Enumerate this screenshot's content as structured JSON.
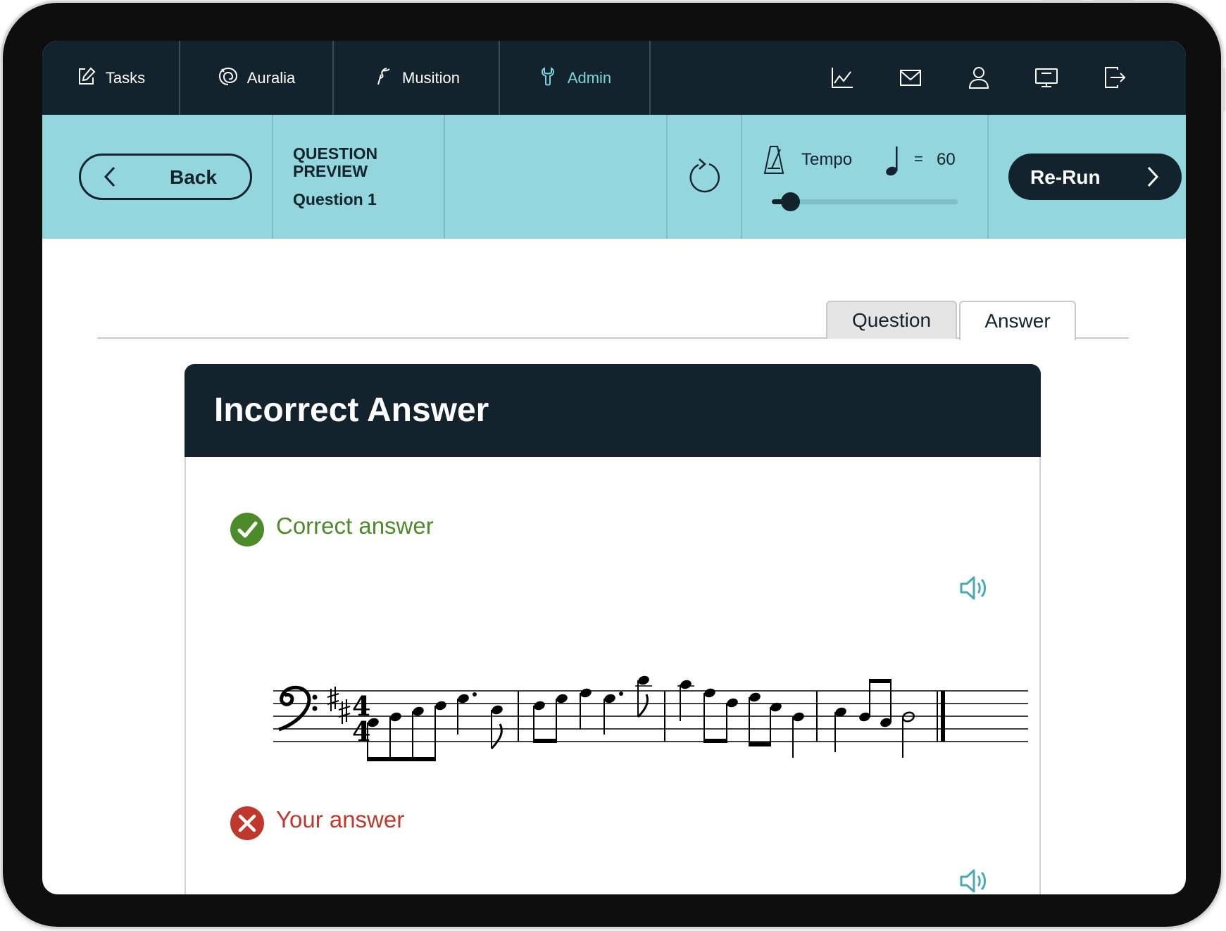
{
  "nav": {
    "items": [
      {
        "label": "Tasks",
        "icon": "edit-icon"
      },
      {
        "label": "Auralia",
        "icon": "auralia-logo-icon"
      },
      {
        "label": "Musition",
        "icon": "musition-logo-icon"
      },
      {
        "label": "Admin",
        "icon": "wrench-icon",
        "active": true
      }
    ],
    "icons": [
      "chart-icon",
      "mail-icon",
      "user-icon",
      "monitor-icon",
      "logout-icon"
    ]
  },
  "toolbar": {
    "back_label": "Back",
    "preview_title": "QUESTION PREVIEW",
    "question_label": "Question 1",
    "tempo_label": "Tempo",
    "tempo_equals": "=",
    "tempo_value": "60",
    "tempo_slider_fraction": 0.1,
    "rerun_label": "Re-Run"
  },
  "tabs": [
    {
      "label": "Question",
      "active": false
    },
    {
      "label": "Answer",
      "active": true
    }
  ],
  "result": {
    "title": "Incorrect Answer",
    "correct_label": "Correct answer",
    "your_label": "Your answer"
  },
  "score": {
    "clef": "bass",
    "key_signature": "2 sharps",
    "time_signature": "4/4",
    "measures": 4
  },
  "colors": {
    "nav_bg": "#13232d",
    "toolbar_bg": "#93d6dd",
    "accent": "#7ad4de",
    "correct": "#4d8a29",
    "incorrect": "#c0382b",
    "speaker": "#4aa8b3"
  }
}
